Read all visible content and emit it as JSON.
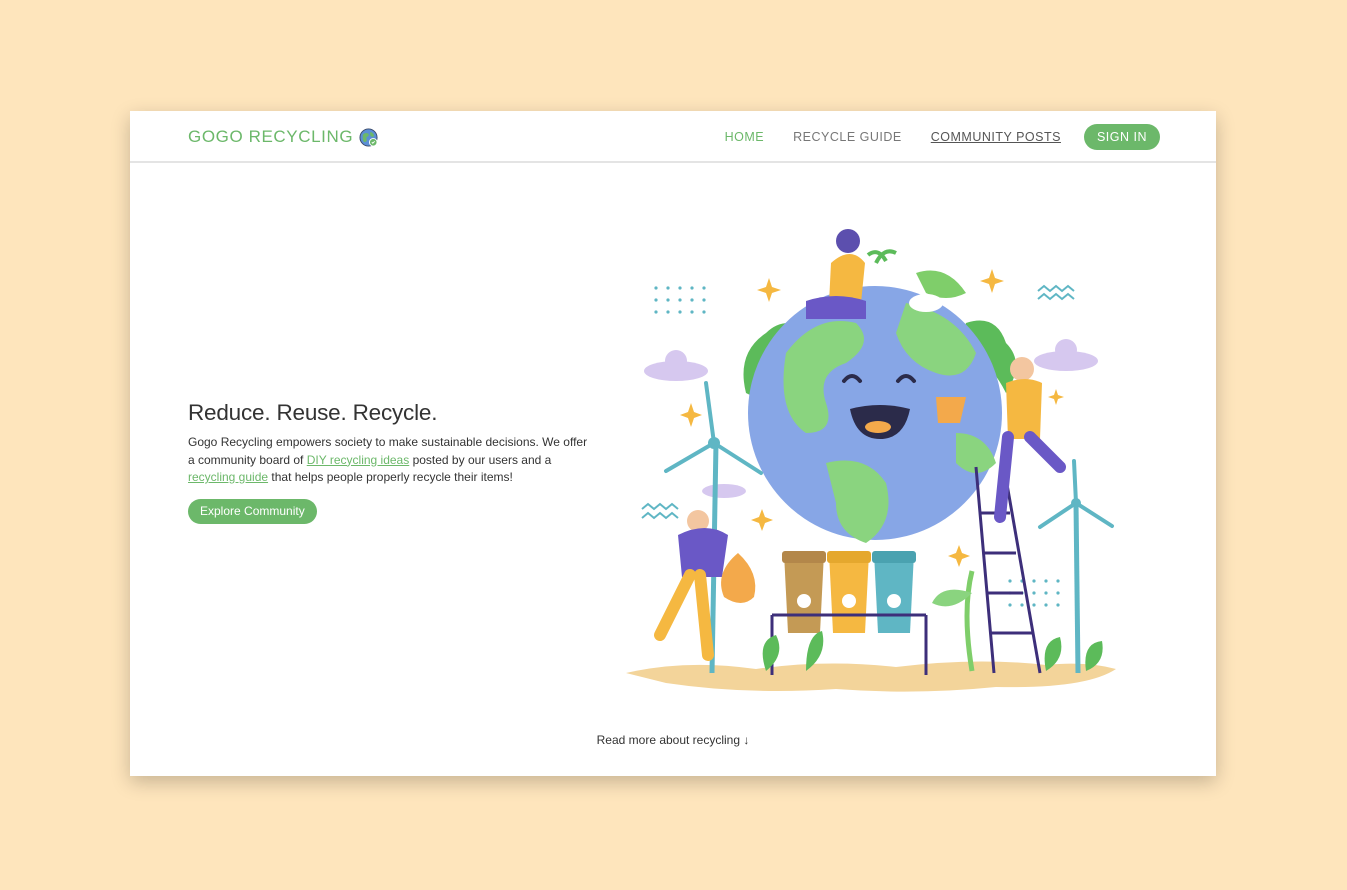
{
  "brand": {
    "name": "GOGO RECYCLING",
    "icon": "globe-icon"
  },
  "nav": {
    "items": [
      {
        "label": "HOME",
        "state": "active"
      },
      {
        "label": "RECYCLE GUIDE",
        "state": "default"
      },
      {
        "label": "COMMUNITY POSTS",
        "state": "underlined"
      }
    ],
    "signin_label": "SIGN IN"
  },
  "hero": {
    "title": "Reduce. Reuse. Recycle.",
    "desc_part1": "Gogo Recycling empowers society to make sustainable decisions. We offer a community board of ",
    "link1": "DIY recycling ideas",
    "desc_part2": " posted by our users and a ",
    "link2": "recycling guide",
    "desc_part3": " that helps people properly recycle their items!",
    "cta_label": "Explore Community"
  },
  "footer": {
    "readmore": "Read more about recycling ↓"
  },
  "colors": {
    "page_bg": "#fee5bc",
    "accent": "#6cb86a",
    "text": "#333333",
    "nav_text": "#777777"
  }
}
